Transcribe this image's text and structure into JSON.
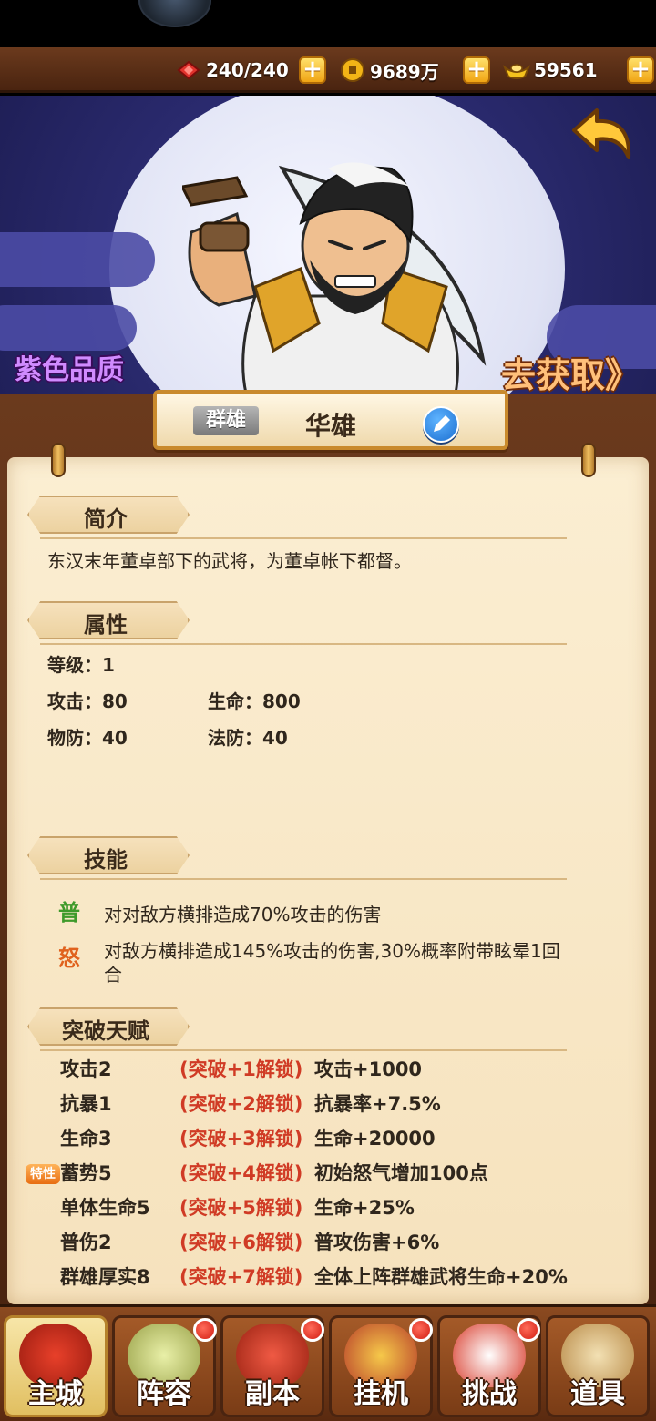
{
  "resources": {
    "stamina": "240/240",
    "gold": "9689万",
    "ingot": "59561"
  },
  "banner": {
    "quality": "紫色品质",
    "get_link": "去获取》"
  },
  "hero": {
    "faction": "群雄",
    "name": "华雄"
  },
  "intro": {
    "title": "简介",
    "text": "东汉末年董卓部下的武将，为董卓帐下都督。"
  },
  "attributes": {
    "title": "属性",
    "level": "等级：1",
    "attack": "攻击：80",
    "hp": "生命：800",
    "pdef": "物防：40",
    "mdef": "法防：40"
  },
  "skills": {
    "title": "技能",
    "items": [
      {
        "icon": "普",
        "text": "对对敌方横排造成70%攻击的伤害"
      },
      {
        "icon": "怒",
        "text_line1": "对敌方横排造成145%攻击的伤害,30%概率附带眩晕1回",
        "text_line2": "合"
      }
    ]
  },
  "talents": {
    "title": "突破天赋",
    "trait_badge": "特性",
    "rows": [
      {
        "name": "攻击2",
        "unlock": "(突破+1解锁)",
        "effect": "攻击+1000"
      },
      {
        "name": "抗暴1",
        "unlock": "(突破+2解锁)",
        "effect": "抗暴率+7.5%"
      },
      {
        "name": "生命3",
        "unlock": "(突破+3解锁)",
        "effect": "生命+20000"
      },
      {
        "name": "蓄势5",
        "unlock": "(突破+4解锁)",
        "effect": "初始怒气增加100点"
      },
      {
        "name": "单体生命5",
        "unlock": "(突破+5解锁)",
        "effect": "生命+25%"
      },
      {
        "name": "普伤2",
        "unlock": "(突破+6解锁)",
        "effect": "普攻伤害+6%"
      },
      {
        "name": "群雄厚实8",
        "unlock": "(突破+7解锁)",
        "effect": "全体上阵群雄武将生命+20%"
      }
    ]
  },
  "nav": [
    {
      "label": "主城",
      "icon": "palace-icon"
    },
    {
      "label": "阵容",
      "icon": "formation-icon"
    },
    {
      "label": "副本",
      "icon": "dungeon-icon"
    },
    {
      "label": "挂机",
      "icon": "idle-icon"
    },
    {
      "label": "挑战",
      "icon": "challenge-icon"
    },
    {
      "label": "道具",
      "icon": "items-icon"
    }
  ],
  "colors": {
    "accent_red": "#d03b25",
    "wood": "#6b3a1d",
    "paper": "#fbeed2",
    "quality_purple": "#d08bff"
  }
}
